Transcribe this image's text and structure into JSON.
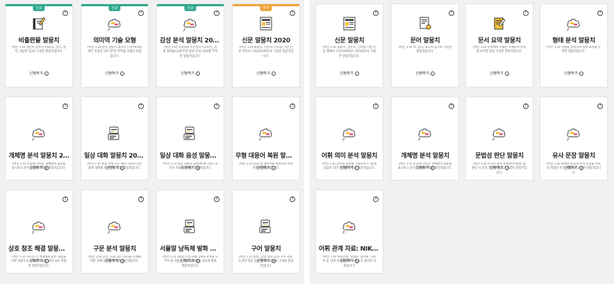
{
  "left_cards": [
    {
      "title": "비출판물 말뭉치",
      "badge": "신규",
      "badge_color": "#2ea88e",
      "bar_color": "#2ea88e",
      "icon": "book-pen-icon",
      "desc": "(버전 1.0) 개인이 글쓰기 자료(시, 일기, 편지, 감상문 등)로 구성된 말뭉치입니다.",
      "apply": "신청하기"
    },
    {
      "title": "의미역 기술 모형",
      "badge": "신규",
      "badge_color": "#2ea88e",
      "bar_color": "#2ea88e",
      "icon": "cloud-label-icon",
      "desc": "(버전 1.0) 문어 말뭉치 의미역 (구문에서의 세부 문장의 의미 분석) 부착을 기술한 모형입니다.",
      "apply": "신청하기"
    },
    {
      "title": "감성 분석 말뭉치 2020",
      "badge": "신규",
      "badge_color": "#2ea88e",
      "bar_color": "#2ea88e",
      "icon": "cloud-label-icon",
      "desc": "(버전 1.0) 작성자의 주관성이 드러나는 감성 표현들(긍정/부정 감성 분석) 정보를 부착한 말뭉치입니다.",
      "apply": "신청하기"
    },
    {
      "title": "신문 말뭉치 2020",
      "badge": "추가",
      "badge_color": "#f0a33a",
      "bar_color": "#f0a33a",
      "icon": "newspaper-icon",
      "desc": "(버전 1.0) 종합지, 전문지, 인터넷 기반 신문 이미지 기사(2019년)로 구성된 말뭉치입니다.",
      "apply": "신청하기"
    },
    {
      "title": "개체명 분석 말뭉치 2…",
      "badge": "",
      "icon": "cloud-label-icon",
      "desc": "(버전 1.0) 문장에 나타난 개체명의 종류를 표시하고 분석 표지를 부착한 말뭉치입니다.",
      "apply": "신청하기",
      "tall": true
    },
    {
      "title": "일상 대화 말뭉치 2020",
      "badge": "",
      "icon": "speech-icon",
      "desc": "(버전 1.0) 특정 주제 또는 제시 자료로 자유롭게 대화를 나눈 일상 대화 말뭉치입니다.",
      "apply": "신청하기",
      "tall": true
    },
    {
      "title": "일상 대화 음성 말뭉치…",
      "badge": "",
      "icon": "speech-icon",
      "desc": "(버전 1.1) 일상 대화의 음성(PCM 자료) 과 전사 자료로 구성된 말뭉치입니다.",
      "apply": "신청하기",
      "tall": true
    },
    {
      "title": "무형 대용어 복원 말뭉…",
      "badge": "",
      "icon": "cloud-label-icon",
      "desc": "(버전 1.0) 문장 내 생략어를 복원하여 따라 복원한 말뭉치입니다.",
      "apply": "신청하기",
      "tall": true
    },
    {
      "title": "상호 참조 해결 말뭉치…",
      "badge": "",
      "icon": "cloud-label-icon",
      "desc": "(버전 1.0) 하나의 각 맥락에서 같은 대상을 다른 표현으로 나타낸 것들을 찾아 서로 연결한 말뭉치입니다.",
      "apply": "신청하기",
      "tall": true
    },
    {
      "title": "구문 분석 말뭉치",
      "badge": "",
      "icon": "cloud-label-icon",
      "desc": "(버전 2.0) 문장 구조(구문 구조)를 단계에 따른 관계 표지를 부착한 말뭉치입니다.",
      "apply": "신청하기",
      "tall": true
    },
    {
      "title": "서울말 낭독체 발화 말…",
      "badge": "",
      "icon": "speech-icon",
      "desc": "(버전 1.0) 20대 다섯 사례, 20대 지역화 거주자 중 서울말 화자 120명의 낭독체 발화 말뭉치입니다.",
      "apply": "신청하기",
      "tall": true
    },
    {
      "title": "구어 말뭉치",
      "badge": "",
      "icon": "speech-icon",
      "desc": "(버전 1.1) 방송, 강의 등의 공적 구어 자료, 드라마 대본 등의 준구어 자료로 구성된 말뭉치입니다.",
      "apply": "신청하기",
      "tall": true
    }
  ],
  "right_cards": [
    {
      "title": "신문 말뭉치",
      "icon": "newspaper-icon",
      "desc": "(버전 2.0) 종합지, 전문지, 인터넷 기반 신문 매체의 기사(2009년~2018년)로 구성된 말뭉치입니다.",
      "apply": "신청하기"
    },
    {
      "title": "문어 말뭉치",
      "icon": "document-icon",
      "desc": "(버전 1.0) 책, 잡지, 보고서 등으로 구성된 말뭉치입니다.",
      "apply": "신청하기"
    },
    {
      "title": "문서 요약 말뭉치",
      "icon": "notepad-icon",
      "desc": "(버전 1.0) 문서에서 추출한 주제문과 문서를 요약한 문장 구성된 말뭉치입니다.",
      "apply": "신청하기"
    },
    {
      "title": "형태 분석 말뭉치",
      "icon": "cloud-label-icon",
      "desc": "(버전 1.0) 어절을 분석하여 형태 표지를 부착한 말뭉치입니다.",
      "apply": "신청하기"
    },
    {
      "title": "어휘 의미 분석 말뭉치",
      "icon": "cloud-label-icon",
      "desc": "(버전 1.0) 단어의 의미를 구별하여 + 중의/동음어 의미 번호를 부착한 말뭉치입니다.",
      "apply": "신청하기",
      "tall": true
    },
    {
      "title": "개체명 분석 말뭉치",
      "icon": "cloud-label-icon",
      "desc": "(버전 1.0) 문장에 나타난 개체명의 종류를 표시하고 분석 표지를 부착한 말뭉치입니다.",
      "apply": "신청하기",
      "tall": true
    },
    {
      "title": "문법성 판단 말뭉치",
      "icon": "cloud-label-icon",
      "desc": "(버전 1.0) 한국어 화자 문법성(수용성) 을 판단 시 문장 평가한 정도가 포함된 말뭉치입니다.",
      "apply": "신청하기",
      "tall": true
    },
    {
      "title": "유사 문장 말뭉치",
      "icon": "cloud-label-icon",
      "desc": "(버전 1.0) 원래의 문장과 유사 문장을 서로의 적합한 유사 문장으로 구성된 말뭉치입니다.",
      "apply": "신청하기",
      "tall": true
    },
    {
      "title": "어휘 관계 자료: NIKLex",
      "icon": "cloud-label-icon",
      "desc": "(버전 1.0) 비슷한말, 반대말, 상하위, 하위어 등 어휘 관계를 언어 사용자가 평가한 자료입니다.",
      "apply": "신청하기",
      "tall": true
    }
  ]
}
